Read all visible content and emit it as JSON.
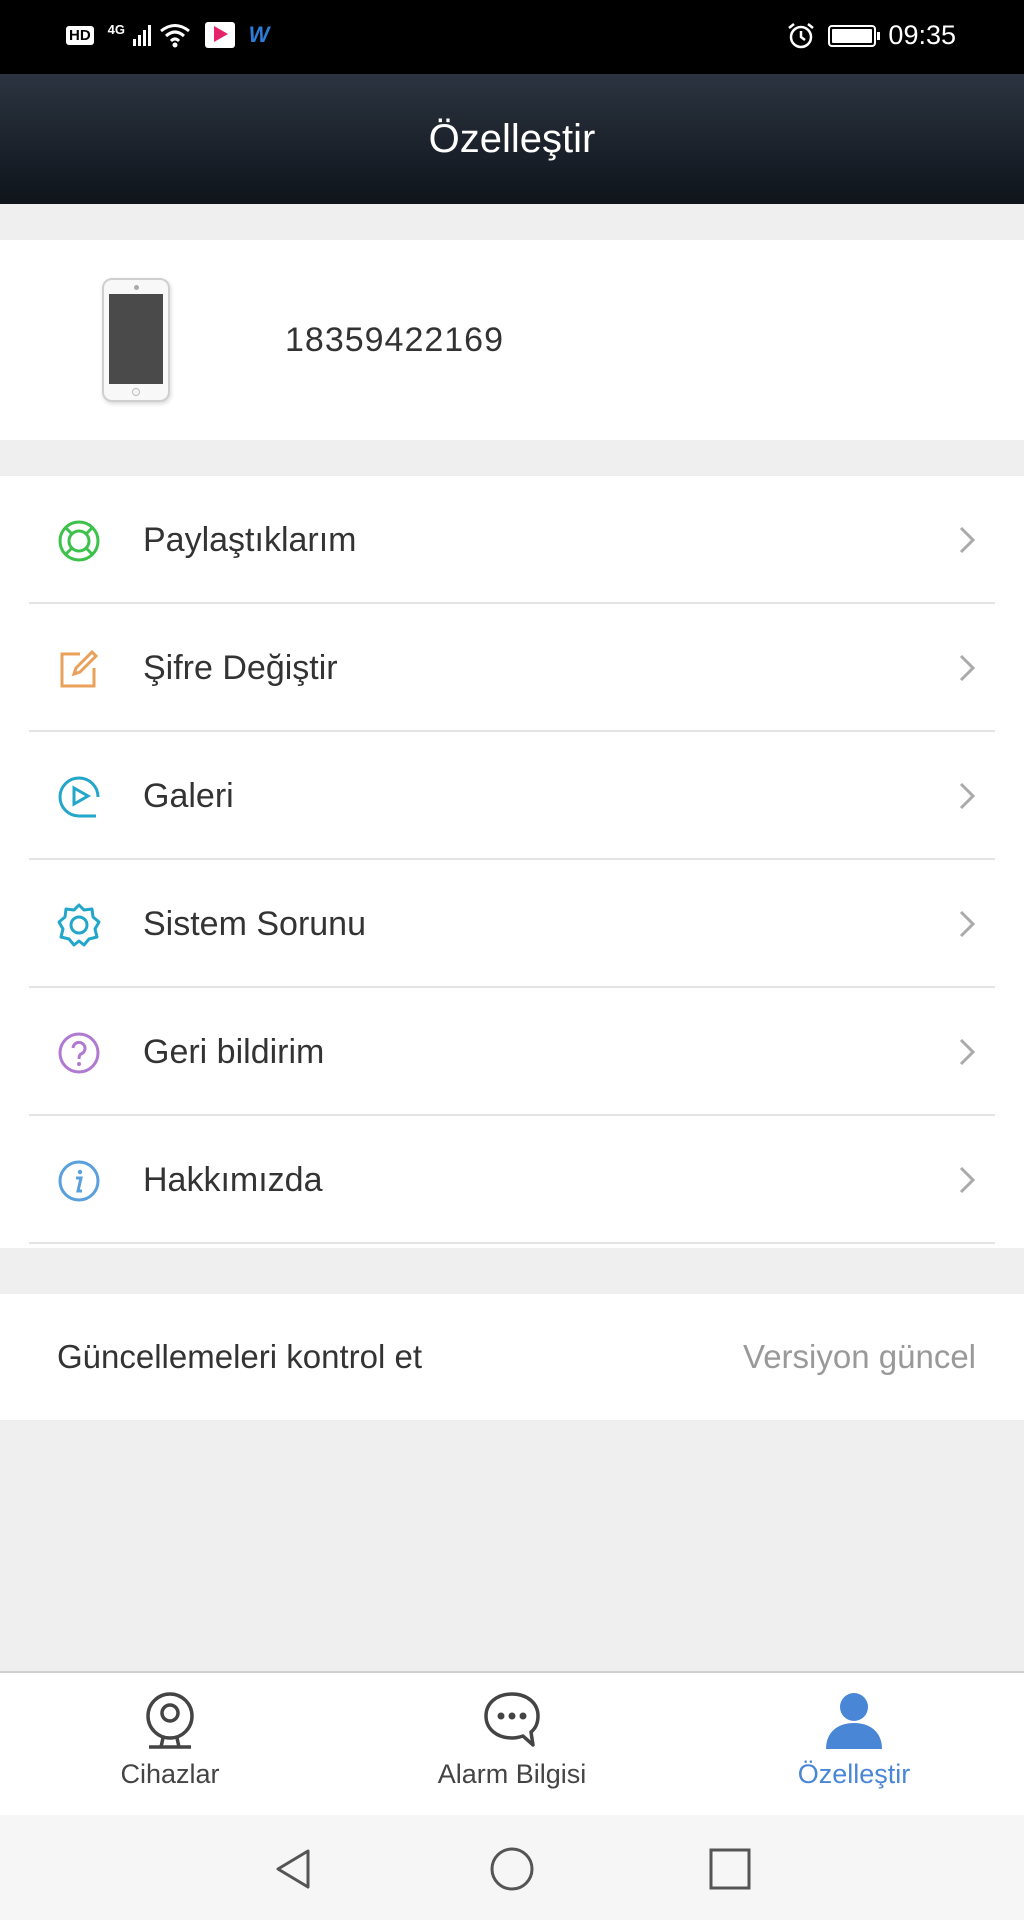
{
  "status_bar": {
    "time": "09:35",
    "network": "4G",
    "hd_label": "HD",
    "app_badge": "W"
  },
  "header": {
    "title": "Özelleştir"
  },
  "profile": {
    "account": "18359422169"
  },
  "menu": {
    "items": [
      {
        "label": "Paylaştıklarım",
        "icon": "share-ring-icon",
        "color": "#3cc24a"
      },
      {
        "label": "Şifre Değiştir",
        "icon": "edit-password-icon",
        "color": "#e9a15a"
      },
      {
        "label": "Galeri",
        "icon": "play-gallery-icon",
        "color": "#22a6c9"
      },
      {
        "label": "Sistem Sorunu",
        "icon": "gear-icon",
        "color": "#22a6c9"
      },
      {
        "label": "Geri bildirim",
        "icon": "question-icon",
        "color": "#b07ad0"
      },
      {
        "label": "Hakkımızda",
        "icon": "info-icon",
        "color": "#5aa0dc"
      }
    ]
  },
  "update": {
    "label": "Güncellemeleri kontrol et",
    "value": "Versiyon güncel"
  },
  "bottom_nav": {
    "tabs": [
      {
        "label": "Cihazlar",
        "icon": "camera-icon"
      },
      {
        "label": "Alarm Bilgisi",
        "icon": "chat-bubble-icon"
      },
      {
        "label": "Özelleştir",
        "icon": "user-icon",
        "active": true
      }
    ],
    "active_color": "#4a86d6"
  }
}
